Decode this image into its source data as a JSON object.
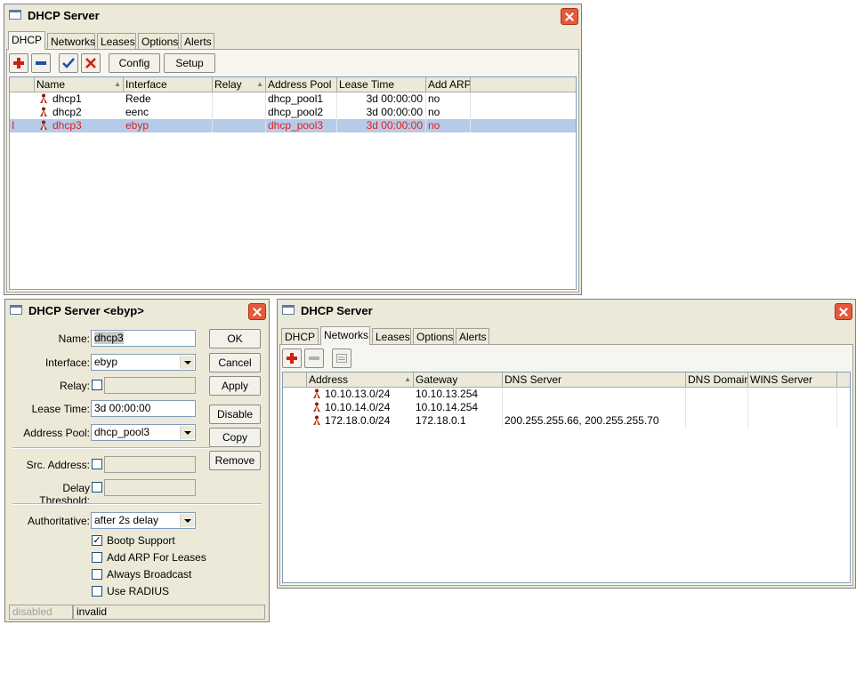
{
  "colors": {
    "add": "#d02010",
    "remove": "#2050a8",
    "check": "#2050a8",
    "cancel": "#d02010",
    "selected_row_text": "#e02020"
  },
  "main": {
    "title": "DHCP Server",
    "tabs": [
      {
        "label": "DHCP"
      },
      {
        "label": "Networks"
      },
      {
        "label": "Leases"
      },
      {
        "label": "Options"
      },
      {
        "label": "Alerts"
      }
    ],
    "toolbar": {
      "config": "Config",
      "setup": "Setup"
    },
    "columns": [
      "Name",
      "Interface",
      "Relay",
      "Address Pool",
      "Lease Time",
      "Add ARP"
    ],
    "rows": [
      {
        "name": "dhcp1",
        "interface": "Rede",
        "relay": "",
        "pool": "dhcp_pool1",
        "lease": "3d 00:00:00",
        "arp": "no"
      },
      {
        "name": "dhcp2",
        "interface": "eenc",
        "relay": "",
        "pool": "dhcp_pool2",
        "lease": "3d 00:00:00",
        "arp": "no"
      },
      {
        "name": "dhcp3",
        "interface": "ebyp",
        "relay": "",
        "pool": "dhcp_pool3",
        "lease": "3d 00:00:00",
        "arp": "no",
        "flag": "I"
      }
    ]
  },
  "editor": {
    "title": "DHCP Server <ebyp>",
    "labels": {
      "name": "Name:",
      "interface": "Interface:",
      "relay": "Relay:",
      "lease": "Lease Time:",
      "pool": "Address Pool:",
      "src": "Src. Address:",
      "delay": "Delay Threshold:",
      "auth": "Authoritative:"
    },
    "values": {
      "name": "dhcp3",
      "interface": "ebyp",
      "lease": "3d 00:00:00",
      "pool": "dhcp_pool3",
      "auth": "after 2s delay"
    },
    "checks": [
      {
        "label": "Bootp Support",
        "checked": "✓"
      },
      {
        "label": "Add ARP For Leases",
        "checked": ""
      },
      {
        "label": "Always Broadcast",
        "checked": ""
      },
      {
        "label": "Use RADIUS",
        "checked": ""
      }
    ],
    "buttons": {
      "ok": "OK",
      "cancel": "Cancel",
      "apply": "Apply",
      "disable": "Disable",
      "copy": "Copy",
      "remove": "Remove"
    },
    "status": {
      "left": "disabled",
      "right": "invalid"
    }
  },
  "networks": {
    "title": "DHCP Server",
    "tabs": [
      {
        "label": "DHCP"
      },
      {
        "label": "Networks"
      },
      {
        "label": "Leases"
      },
      {
        "label": "Options"
      },
      {
        "label": "Alerts"
      }
    ],
    "columns": [
      "Address",
      "Gateway",
      "DNS Server",
      "DNS Domain",
      "WINS Server"
    ],
    "rows": [
      {
        "address": "10.10.13.0/24",
        "gateway": "10.10.13.254",
        "dns": "",
        "domain": "",
        "wins": ""
      },
      {
        "address": "10.10.14.0/24",
        "gateway": "10.10.14.254",
        "dns": "",
        "domain": "",
        "wins": ""
      },
      {
        "address": "172.18.0.0/24",
        "gateway": "172.18.0.1",
        "dns": "200.255.255.66, 200.255.255.70",
        "domain": "",
        "wins": ""
      }
    ]
  }
}
